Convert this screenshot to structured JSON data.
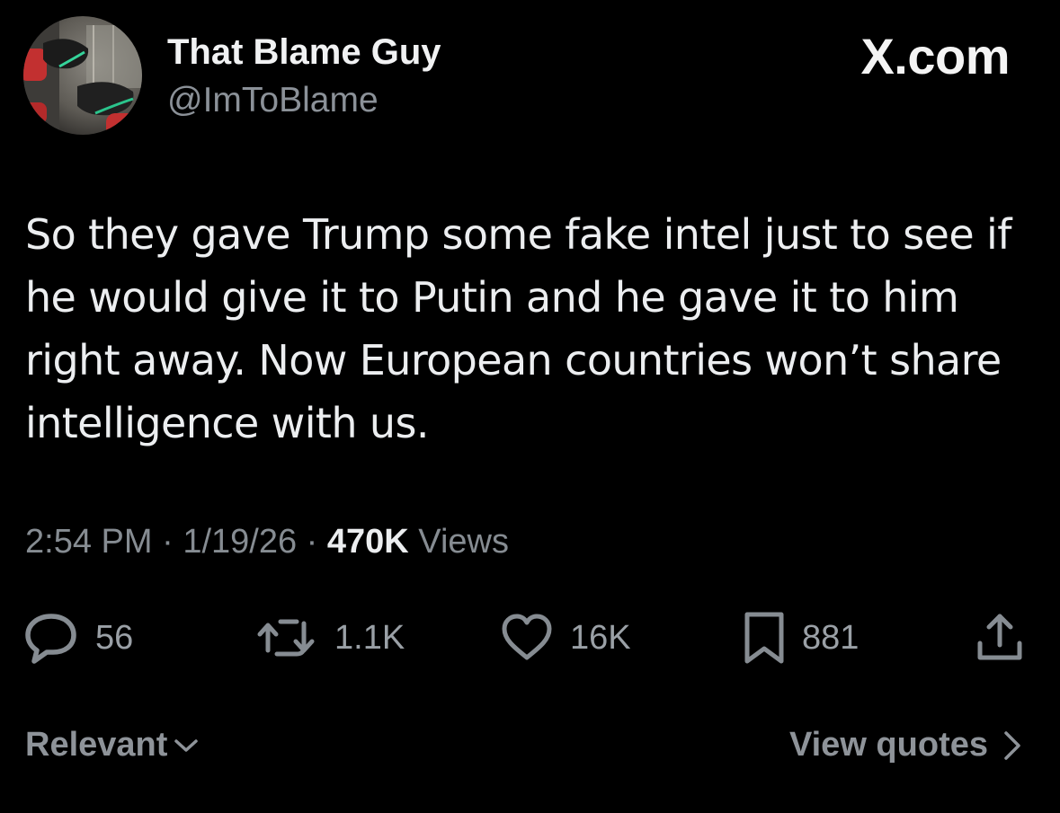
{
  "author": {
    "display_name": "That Blame Guy",
    "handle": "@ImToBlame",
    "avatar_icon": "avatar-photo-feet-sneakers"
  },
  "site": {
    "label": "X.com"
  },
  "tweet": {
    "text": "So they gave Trump some fake intel just to see if he would give it to Putin and he gave it to him right away. Now European countries won’t share intelligence with us.",
    "time": "2:54 PM",
    "date": "1/19/26",
    "separator": "·",
    "views_count": "470K",
    "views_label": "Views"
  },
  "actions": {
    "replies": {
      "icon": "reply-bubble-icon",
      "count": "56"
    },
    "reposts": {
      "icon": "repost-icon",
      "count": "1.1K"
    },
    "likes": {
      "icon": "heart-icon",
      "count": "16K"
    },
    "bookmarks": {
      "icon": "bookmark-icon",
      "count": "881"
    },
    "share": {
      "icon": "share-icon"
    }
  },
  "footer": {
    "sort_label": "Relevant",
    "quotes_link": "View quotes"
  },
  "colors": {
    "background": "#000000",
    "primary_text": "#e7e9ea",
    "secondary_text": "#868c92"
  }
}
